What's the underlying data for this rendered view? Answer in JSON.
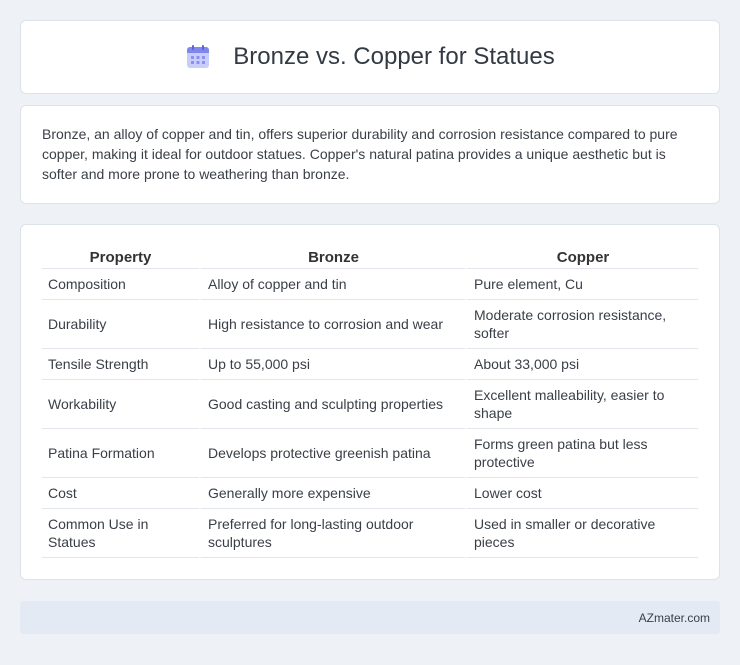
{
  "header": {
    "title": "Bronze vs. Copper for Statues",
    "icon": "calendar-icon"
  },
  "summary": {
    "text": "Bronze, an alloy of copper and tin, offers superior durability and corrosion resistance compared to pure copper, making it ideal for outdoor statues. Copper's natural patina provides a unique aesthetic but is softer and more prone to weathering than bronze."
  },
  "table": {
    "headers": [
      "Property",
      "Bronze",
      "Copper"
    ],
    "rows": [
      [
        "Composition",
        "Alloy of copper and tin",
        "Pure element, Cu"
      ],
      [
        "Durability",
        "High resistance to corrosion and wear",
        "Moderate corrosion resistance, softer"
      ],
      [
        "Tensile Strength",
        "Up to 55,000 psi",
        "About 33,000 psi"
      ],
      [
        "Workability",
        "Good casting and sculpting properties",
        "Excellent malleability, easier to shape"
      ],
      [
        "Patina Formation",
        "Develops protective greenish patina",
        "Forms green patina but less protective"
      ],
      [
        "Cost",
        "Generally more expensive",
        "Lower cost"
      ],
      [
        "Common Use in Statues",
        "Preferred for long-lasting outdoor sculptures",
        "Used in smaller or decorative pieces"
      ]
    ]
  },
  "footer": {
    "text": "AZmater.com"
  },
  "colors": {
    "background": "#eef2f7",
    "card": "#ffffff",
    "footer_bar": "#e4eaf3",
    "icon_accent": "#8b8ff0"
  }
}
